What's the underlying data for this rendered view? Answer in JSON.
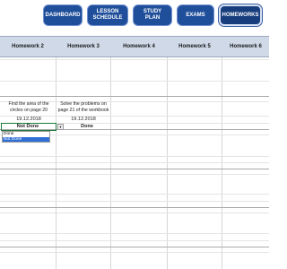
{
  "nav": {
    "buttons": [
      {
        "label_line1": "DASHBOARD",
        "label_line2": ""
      },
      {
        "label_line1": "LESSON",
        "label_line2": "SCHEDULE"
      },
      {
        "label_line1": "STUDY",
        "label_line2": "PLAN"
      },
      {
        "label_line1": "EXAMS",
        "label_line2": ""
      },
      {
        "label_line1": "HOMEWORKS",
        "label_line2": ""
      }
    ],
    "active": "HOMEWORKS"
  },
  "table": {
    "headers": [
      "Homework 2",
      "Homework 3",
      "Homework 4",
      "Homework 5",
      "Homework 6"
    ],
    "row": {
      "col1_text": "Find the area of the circles on page 20",
      "col2_text": "Solve the problems on page 21 of the workbook",
      "col1_date": "19.12.2018",
      "col2_date": "19.12.2018",
      "col1_status": "Not Done",
      "col2_status": "Done"
    }
  },
  "dropdown": {
    "options": [
      "Done",
      "Not Done"
    ],
    "selected": "Not Done"
  },
  "colors": {
    "nav_bg": "#1f4e9a",
    "header_bg": "#cfd9e8",
    "selection": "#2f6fd6"
  }
}
